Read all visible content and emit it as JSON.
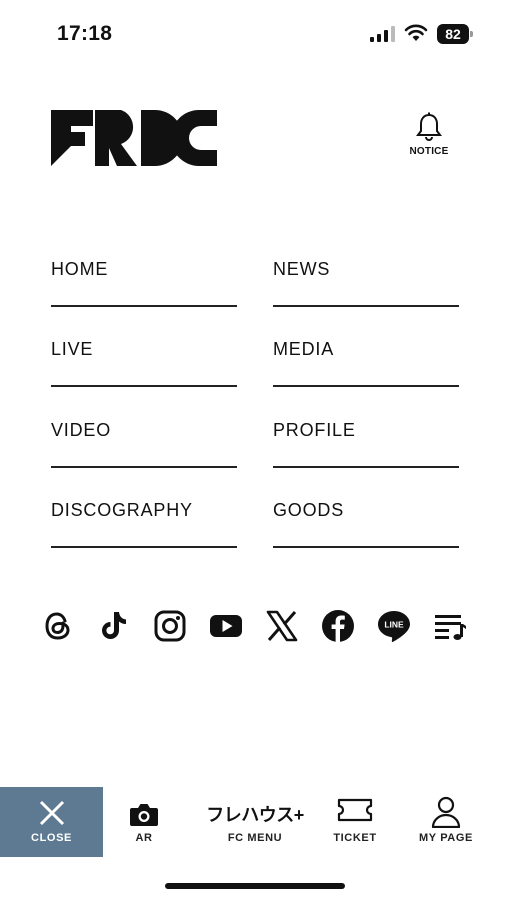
{
  "status_bar": {
    "time": "17:18",
    "battery": "82"
  },
  "header": {
    "logo_text": "FRDC",
    "notice_label": "NOTICE"
  },
  "menu": {
    "items": [
      {
        "label": "HOME"
      },
      {
        "label": "NEWS"
      },
      {
        "label": "LIVE"
      },
      {
        "label": "MEDIA"
      },
      {
        "label": "VIDEO"
      },
      {
        "label": "PROFILE"
      },
      {
        "label": "DISCOGRAPHY"
      },
      {
        "label": "GOODS"
      }
    ]
  },
  "social": {
    "icons": [
      "threads-icon",
      "tiktok-icon",
      "instagram-icon",
      "youtube-icon",
      "x-icon",
      "facebook-icon",
      "line-icon",
      "playlist-icon"
    ],
    "line_text": "LINE"
  },
  "bottom_nav": {
    "close_label": "CLOSE",
    "ar_label": "AR",
    "fc_text": "フレハウス+",
    "fc_menu_label": "FC MENU",
    "ticket_label": "TICKET",
    "mypage_label": "MY PAGE"
  },
  "colors": {
    "close_background": "#5e7a92",
    "text": "#111111",
    "background": "#ffffff"
  }
}
